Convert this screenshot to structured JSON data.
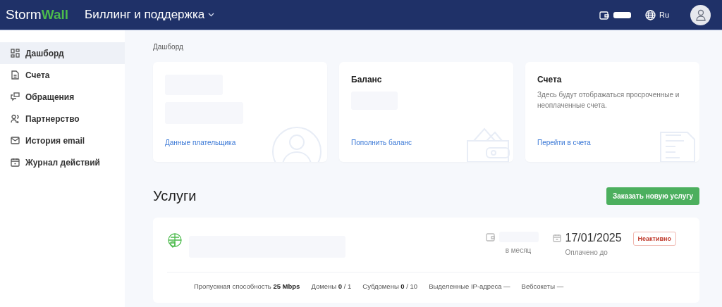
{
  "header": {
    "logo": {
      "part_1": "Storm",
      "part_2": "Wall"
    },
    "section": "Биллинг и поддержка",
    "language": "Ru"
  },
  "sidebar": {
    "items": [
      {
        "label": "Дашборд",
        "selected": true
      },
      {
        "label": "Счета",
        "selected": false
      },
      {
        "label": "Обращения",
        "selected": false
      },
      {
        "label": "Партнерство",
        "selected": false
      },
      {
        "label": "История email",
        "selected": false
      },
      {
        "label": "Журнал действий",
        "selected": false
      }
    ]
  },
  "breadcrumb": "Дашборд",
  "cards": [
    {
      "kind": "payer",
      "link": "Данные плательщика"
    },
    {
      "kind": "balance",
      "title": "Баланс",
      "link": "Пополнить баланс"
    },
    {
      "kind": "invoices",
      "title": "Счета",
      "text": "Здесь будут отображаться просроченные и неоплаченные счета.",
      "link": "Перейти в счета"
    }
  ],
  "services": {
    "title": "Услуги",
    "order_button": "Заказать новую услугу",
    "items": [
      {
        "price_caption": "в месяц",
        "paid_until": "17/01/2025",
        "paid_caption": "Оплачено до",
        "status": {
          "label": "Неактивно",
          "kind": "inactive"
        },
        "specs": [
          "Пропускная способность **25 Mbps**",
          "Домены **0** / 1",
          "Субдомены **0** / 10",
          "Выделенные IP-адреса —",
          "Вебсокеты —"
        ]
      }
    ]
  }
}
